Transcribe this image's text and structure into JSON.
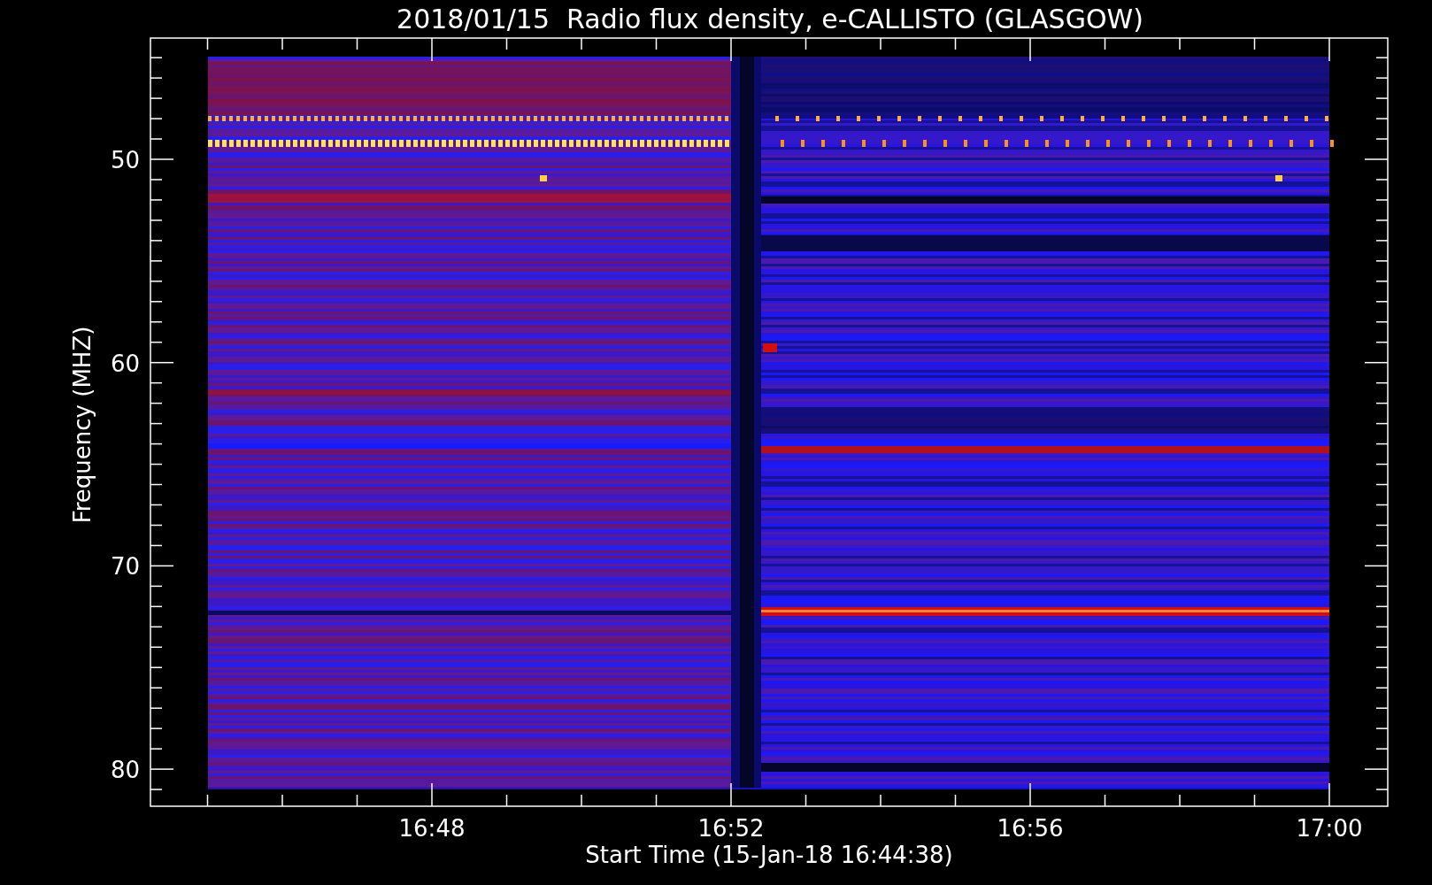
{
  "title": "2018/01/15  Radio flux density, e-CALLISTO (GLASGOW)",
  "y_axis": {
    "label": "Frequency (MHZ)",
    "tick_labels": [
      "50",
      "60",
      "70",
      "80"
    ]
  },
  "x_axis": {
    "label": "Start Time (15-Jan-18 16:44:38)",
    "tick_labels": [
      "16:48",
      "16:52",
      "16:56",
      "17:00"
    ]
  }
}
